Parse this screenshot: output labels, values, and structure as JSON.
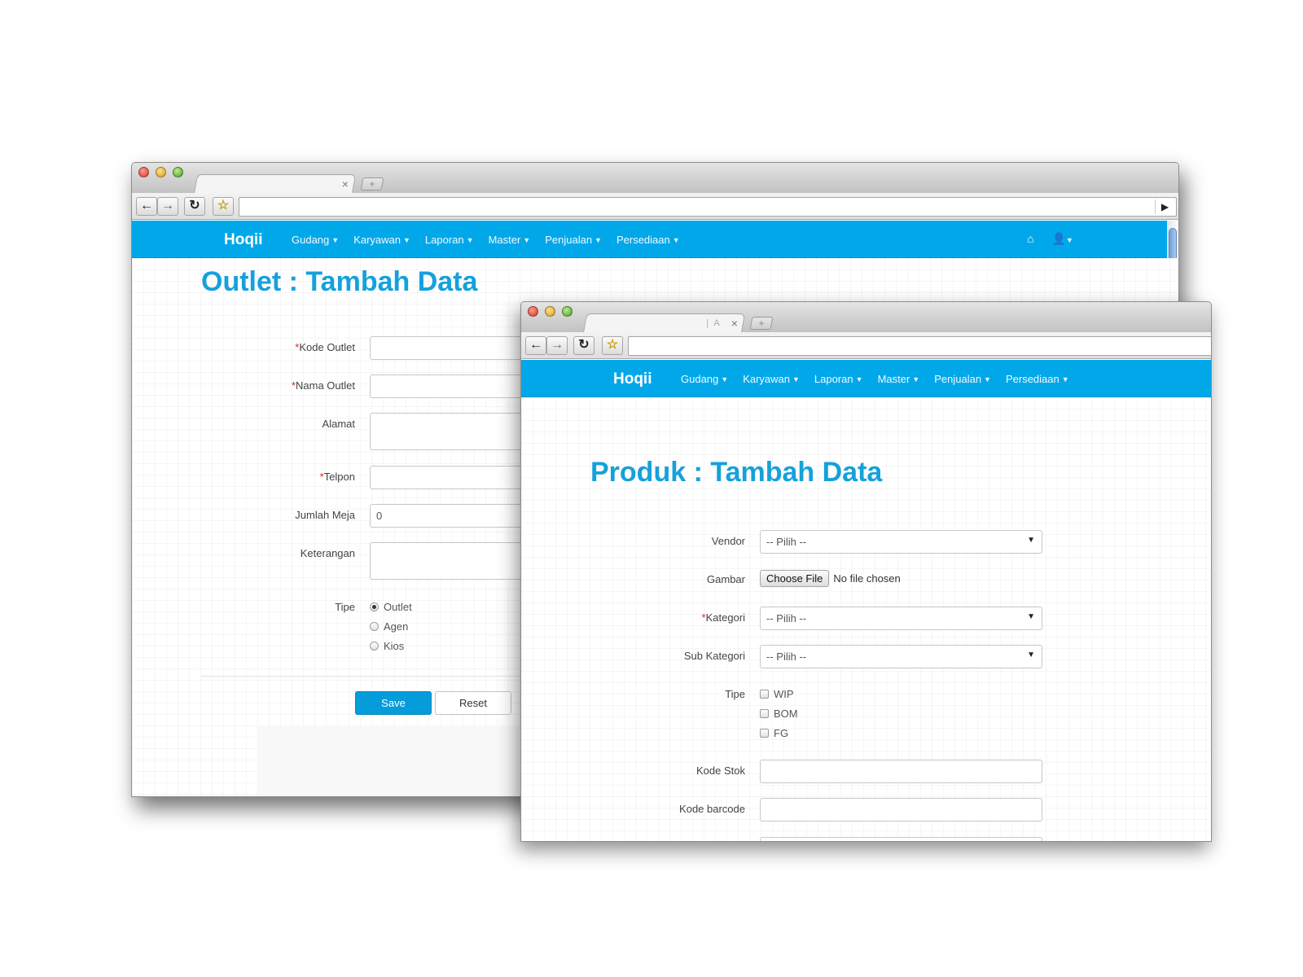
{
  "outlet_window": {
    "brand": "Hoqii",
    "menu": [
      "Gudang",
      "Karyawan",
      "Laporan",
      "Master",
      "Penjualan",
      "Persediaan"
    ],
    "title": "Outlet : Tambah Data",
    "fields": {
      "kode_outlet": "Kode Outlet",
      "nama_outlet": "Nama Outlet",
      "alamat": "Alamat",
      "telpon": "Telpon",
      "jumlah_meja": "Jumlah Meja",
      "jumlah_meja_value": "0",
      "keterangan": "Keterangan",
      "tipe": "Tipe"
    },
    "tipe_options": [
      "Outlet",
      "Agen",
      "Kios"
    ],
    "tipe_selected": "Outlet",
    "save_label": "Save",
    "reset_label": "Reset",
    "required_mark": "*"
  },
  "produk_window": {
    "brand": "Hoqii",
    "tab_title": "| A",
    "menu": [
      "Gudang",
      "Karyawan",
      "Laporan",
      "Master",
      "Penjualan",
      "Persediaan"
    ],
    "title": "Produk : Tambah Data",
    "fields": {
      "vendor": "Vendor",
      "vendor_value": "-- Pilih --",
      "gambar": "Gambar",
      "choose_file": "Choose File",
      "no_file": "No file chosen",
      "kategori": "Kategori",
      "kategori_value": "-- Pilih --",
      "sub_kategori": "Sub Kategori",
      "sub_kategori_value": "-- Pilih --",
      "tipe": "Tipe",
      "kode_stok": "Kode Stok",
      "kode_barcode": "Kode barcode"
    },
    "tipe_options": [
      "WIP",
      "BOM",
      "FG"
    ],
    "required_mark": "*"
  },
  "colors": {
    "navbar": "#00a8ea",
    "title": "#14a1dc",
    "primary_button": "#049cdb",
    "required": "#d9241c"
  },
  "icons": {
    "back": "arrow-left-icon",
    "forward": "arrow-right-icon",
    "reload": "reload-icon",
    "bookmark": "star-icon",
    "home": "home-icon",
    "user": "user-icon"
  }
}
